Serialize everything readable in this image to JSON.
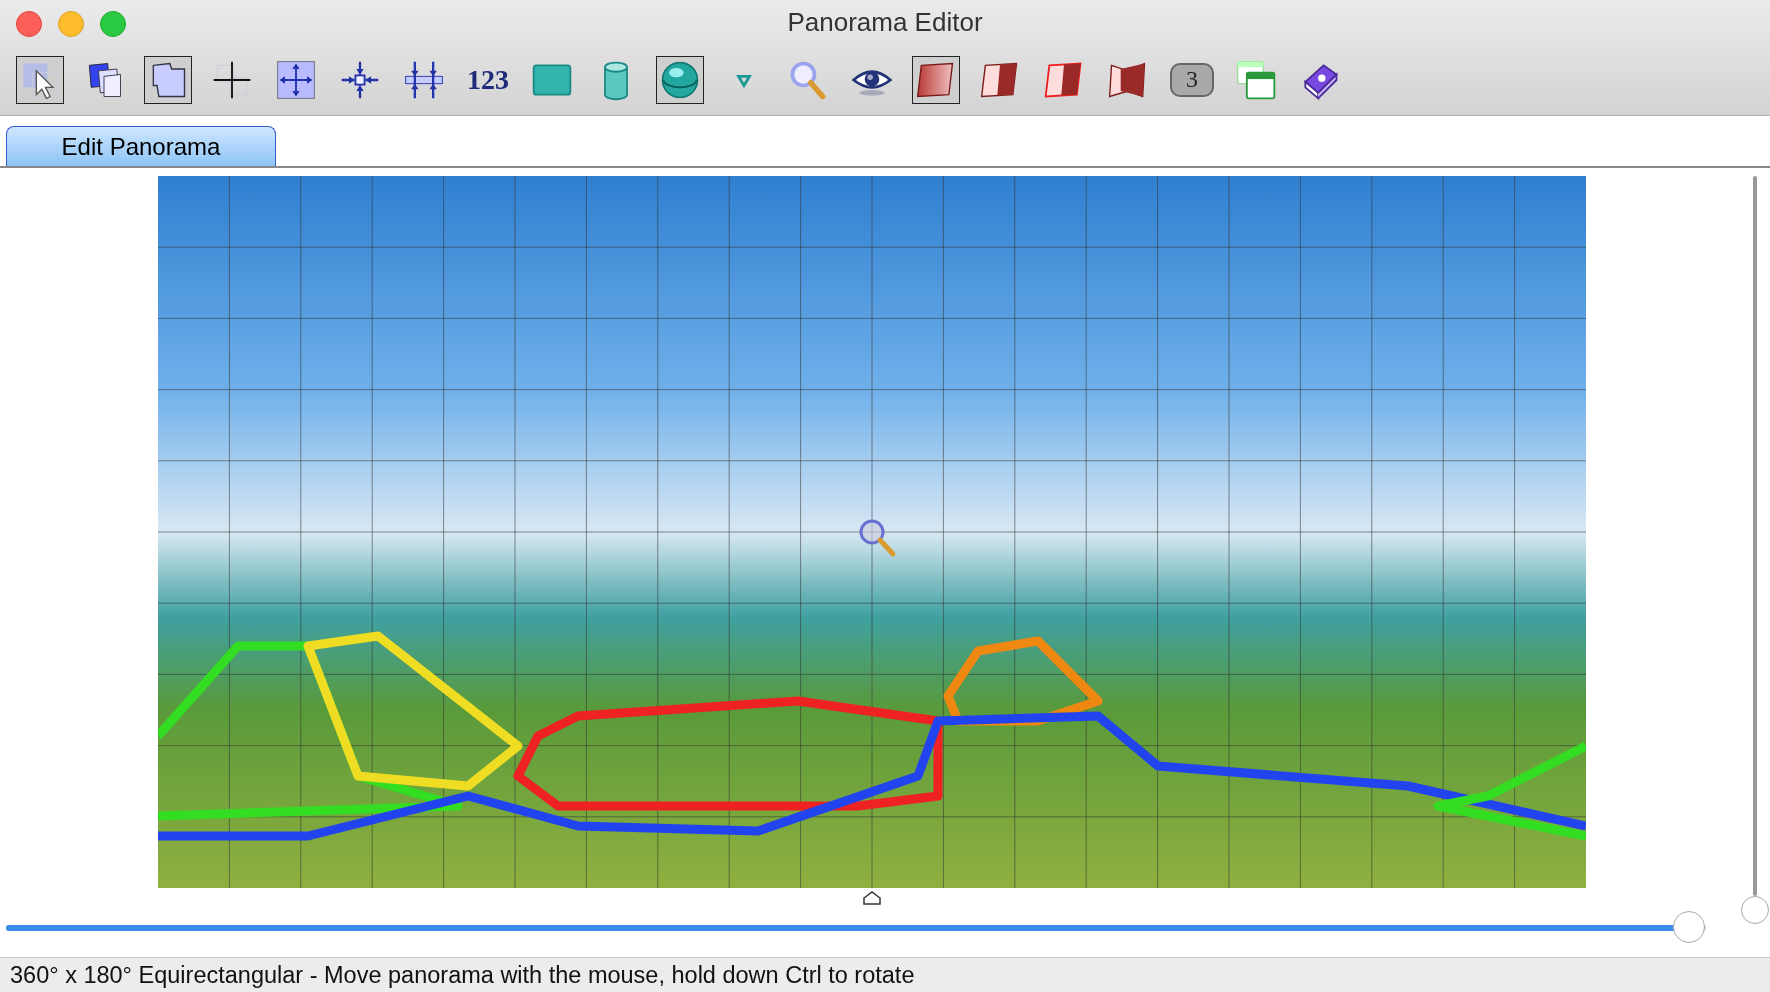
{
  "window": {
    "title": "Panorama Editor"
  },
  "toolbar": [
    {
      "kind": "arrow",
      "selected": true
    },
    {
      "kind": "copy",
      "selected": false
    },
    {
      "kind": "shape",
      "selected": true
    },
    {
      "kind": "cross",
      "selected": false
    },
    {
      "kind": "expand",
      "selected": false
    },
    {
      "kind": "move",
      "selected": false
    },
    {
      "kind": "compress",
      "selected": false
    },
    {
      "kind": "text",
      "label": "123",
      "selected": false
    },
    {
      "kind": "rect",
      "selected": false
    },
    {
      "kind": "cylinder",
      "selected": false
    },
    {
      "kind": "sphere",
      "selected": true
    },
    {
      "kind": "dropdown",
      "selected": false
    },
    {
      "kind": "search",
      "selected": false
    },
    {
      "kind": "eye",
      "selected": false
    },
    {
      "kind": "quad",
      "selected": true
    },
    {
      "kind": "halfquad",
      "selected": false
    },
    {
      "kind": "halfquadred",
      "selected": false
    },
    {
      "kind": "bentquad",
      "selected": false
    },
    {
      "kind": "badge",
      "label": "3",
      "selected": false
    },
    {
      "kind": "window",
      "selected": false
    },
    {
      "kind": "book",
      "selected": false
    }
  ],
  "tabs": [
    {
      "label": "Edit Panorama",
      "selected": true
    }
  ],
  "regions": [
    {
      "color": "#33dd22"
    },
    {
      "color": "#eedd22"
    },
    {
      "color": "#ee2222"
    },
    {
      "color": "#ee8811"
    },
    {
      "color": "#2244ee"
    },
    {
      "color": "#33dd22"
    }
  ],
  "vertical_slider": {
    "level": 1
  },
  "horizontal_slider": {
    "level": 0.99
  },
  "status_bar": "360° x 180° Equirectangular - Move panorama with the mouse, hold down Ctrl to rotate"
}
